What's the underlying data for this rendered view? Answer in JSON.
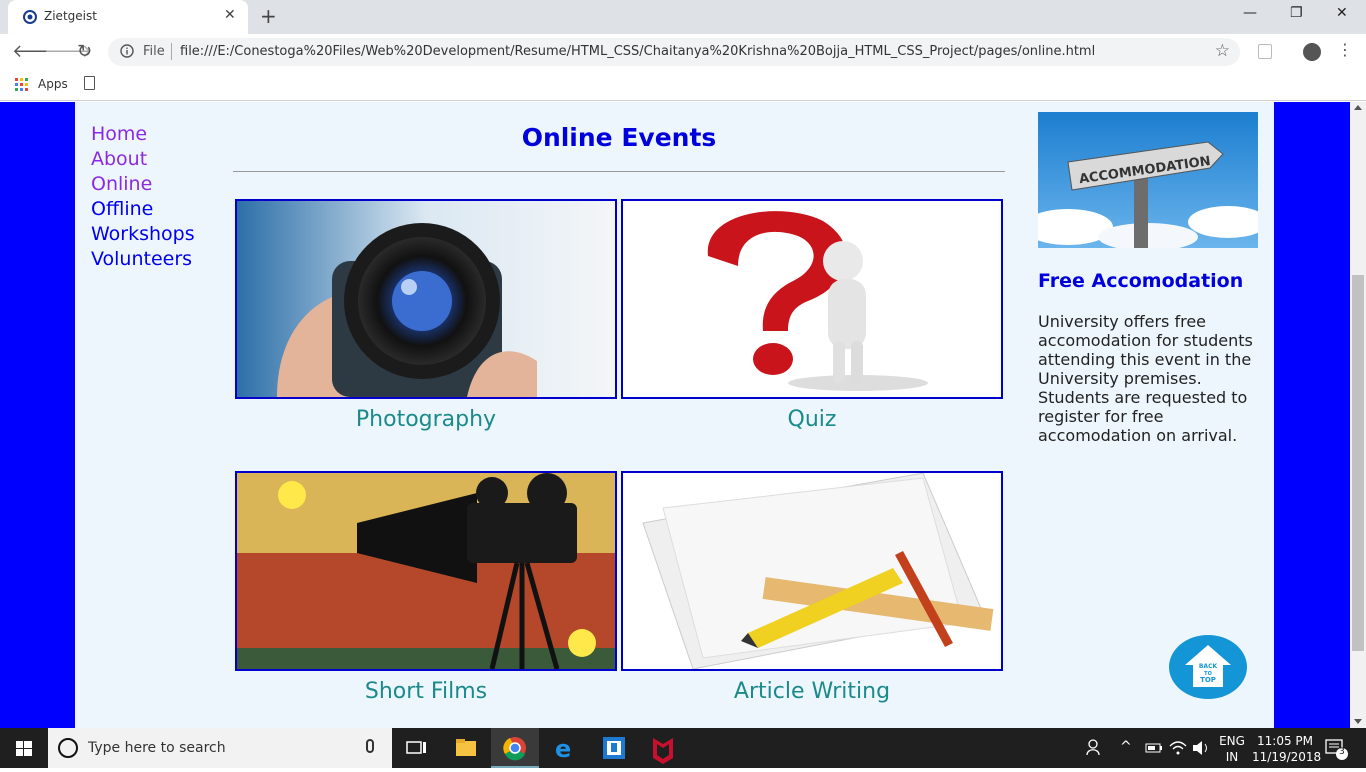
{
  "browser": {
    "tab_title": "Zietgeist",
    "new_tab": "+",
    "omnibox_label": "File",
    "url": "file:///E:/Conestoga%20Files/Web%20Development/Resume/HTML_CSS/Chaitanya%20Krishna%20Bojja_HTML_CSS_Project/pages/online.html",
    "bookmarks_apps": "Apps"
  },
  "nav": {
    "items": [
      {
        "label": "Home",
        "visited": true
      },
      {
        "label": "About",
        "visited": true
      },
      {
        "label": "Online",
        "visited": true
      },
      {
        "label": "Offline",
        "visited": false
      },
      {
        "label": "Workshops",
        "visited": false
      },
      {
        "label": "Volunteers",
        "visited": false
      }
    ]
  },
  "main": {
    "title": "Online Events",
    "events": [
      {
        "caption": "Photography",
        "icon": "camera-lens-image"
      },
      {
        "caption": "Quiz",
        "icon": "question-mark-figure-image"
      },
      {
        "caption": "Short Films",
        "icon": "film-projector-image"
      },
      {
        "caption": "Article Writing",
        "icon": "article-writing-image"
      }
    ]
  },
  "aside": {
    "image_sign_text": "ACCOMMODATION",
    "title": "Free Accomodation",
    "text": "University offers free accomodation for students attending this event in the University premises. Students are requested to register for free accomodation on arrival."
  },
  "back_to_top": {
    "line1": "BACK",
    "line2": "TO",
    "line3": "TOP"
  },
  "taskbar": {
    "search_placeholder": "Type here to search",
    "lang_top": "ENG",
    "lang_bottom": "IN",
    "time": "11:05 PM",
    "date": "11/19/2018",
    "notification_count": "3"
  },
  "colors": {
    "page_outer": "#0000ff",
    "page_inner": "#eef6fd",
    "title_blue": "#0000dd",
    "caption_teal": "#1b8a8a",
    "nav_visited": "#8a2be2",
    "nav_unvisited": "#0000ee",
    "frame_border": "#0000cc"
  }
}
